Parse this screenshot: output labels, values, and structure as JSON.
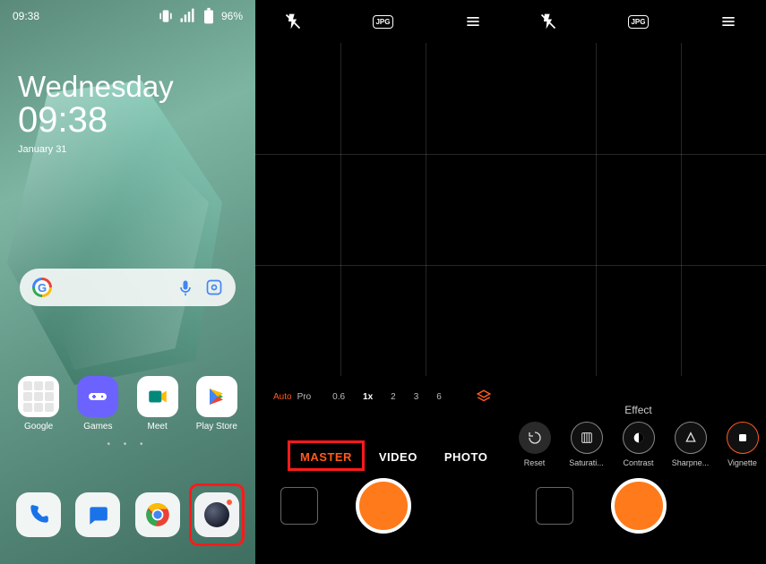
{
  "home": {
    "status": {
      "time": "09:38",
      "battery": "96%"
    },
    "day": "Wednesday",
    "clock": "09:38",
    "date": "January 31",
    "apps": [
      {
        "label": "Google"
      },
      {
        "label": "Games"
      },
      {
        "label": "Meet"
      },
      {
        "label": "Play Store"
      }
    ]
  },
  "cam1": {
    "top": {
      "format": "JPG"
    },
    "zoom": {
      "auto": "Auto",
      "pro": "Pro",
      "options": [
        "0.6",
        "1x",
        "2",
        "3",
        "6"
      ],
      "active": "1x"
    },
    "modes": [
      "MASTER",
      "VIDEO",
      "PHOTO"
    ],
    "active_mode": "MASTER"
  },
  "cam2": {
    "top": {
      "format": "JPG"
    },
    "effect_label": "Effect",
    "effects": [
      {
        "name": "Reset"
      },
      {
        "name": "Saturati..."
      },
      {
        "name": "Contrast"
      },
      {
        "name": "Sharpne..."
      },
      {
        "name": "Vignette"
      }
    ],
    "active_effect": "Vignette"
  }
}
